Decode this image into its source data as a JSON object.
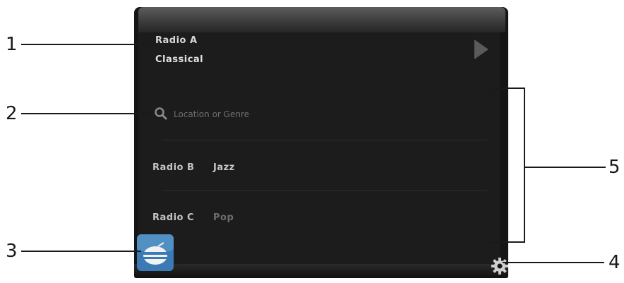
{
  "now_playing": {
    "station": "Radio A",
    "genre": "Classical"
  },
  "search": {
    "placeholder": "Location or Genre"
  },
  "stations": [
    {
      "station": "Radio B",
      "genre": "Jazz",
      "genre_color": "#c8c8c8"
    },
    {
      "station": "Radio C",
      "genre": "Pop",
      "genre_color": "#6e6e6e"
    }
  ],
  "callouts": [
    "1",
    "2",
    "3",
    "4",
    "5"
  ],
  "icons": {
    "play": "play-icon",
    "search": "search-icon",
    "app": "radio-app-icon",
    "settings": "gear-icon"
  }
}
